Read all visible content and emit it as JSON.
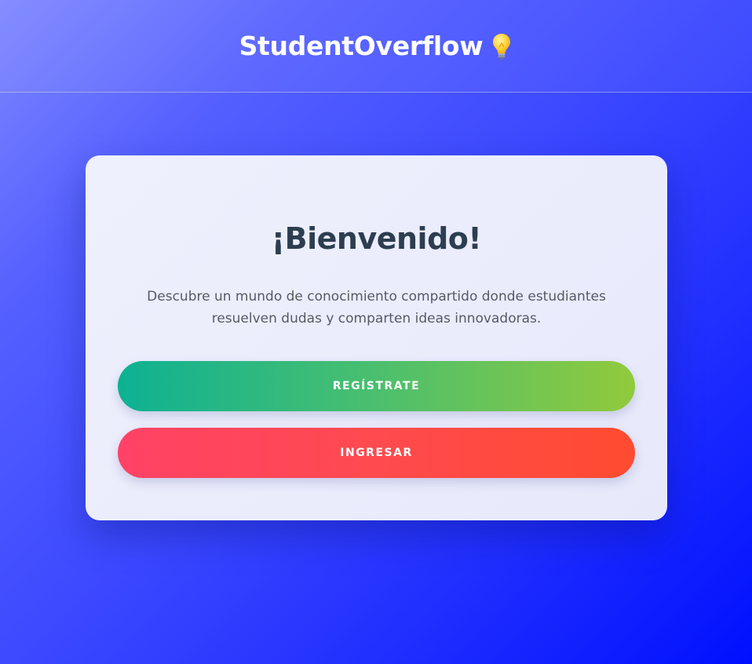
{
  "header": {
    "brand": "StudentOverflow",
    "brand_icon": "lightbulb-icon"
  },
  "card": {
    "title": "¡Bienvenido!",
    "description": "Descubre un mundo de conocimiento compartido donde estudiantes resuelven dudas y comparten ideas innovadoras.",
    "register_label": "REGÍSTRATE",
    "login_label": "INGRESAR"
  },
  "colors": {
    "background_start": "#7d87ff",
    "background_end": "#0010ff",
    "title": "#2c3e50",
    "register_gradient": [
      "#0db193",
      "#91ca3c"
    ],
    "login_gradient": [
      "#ff4266",
      "#ff4b2f"
    ]
  }
}
